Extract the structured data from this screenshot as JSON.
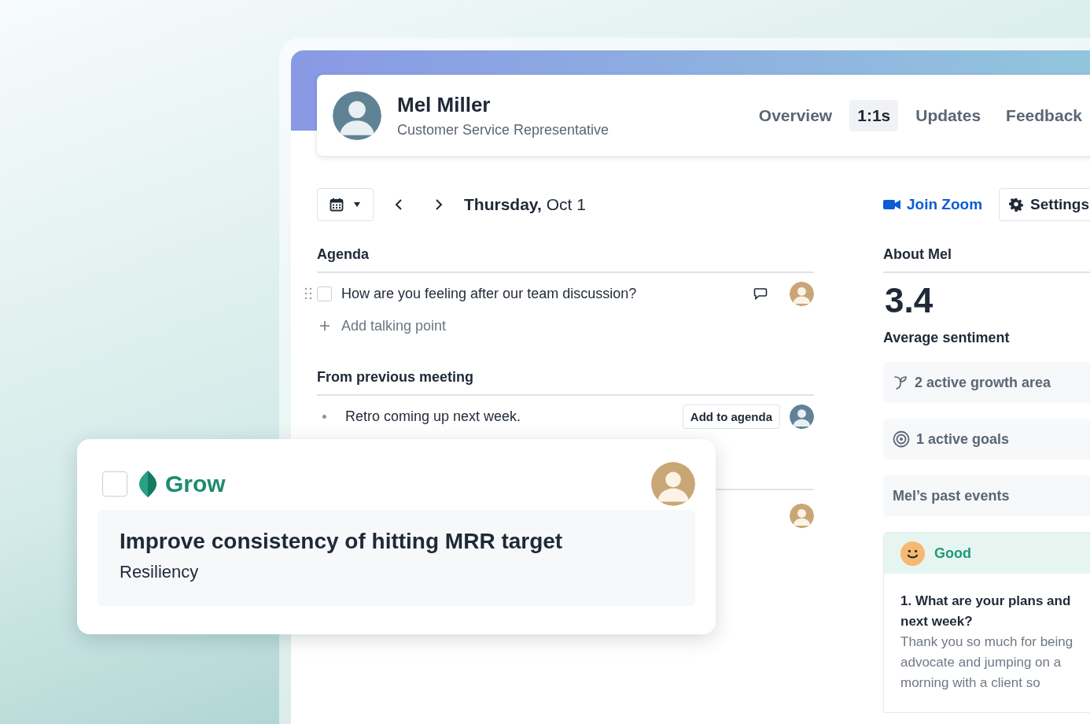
{
  "profile": {
    "name": "Mel Miller",
    "role": "Customer Service Representative"
  },
  "tabs": [
    {
      "label": "Overview",
      "selected": false
    },
    {
      "label": "1:1s",
      "selected": true
    },
    {
      "label": "Updates",
      "selected": false
    },
    {
      "label": "Feedback",
      "selected": false
    }
  ],
  "date": "**Thursday,** Oct 1",
  "agenda": {
    "title": "Agenda",
    "items": [
      {
        "text": "How are you feeling after our team discussion?",
        "checked": false
      }
    ],
    "add_label": "Add talking point"
  },
  "previous": {
    "title": "From previous meeting",
    "items": [
      {
        "text": "Retro coming up next week.",
        "action": "Add to agenda"
      }
    ]
  },
  "actions": {
    "join": "Join Zoom",
    "settings": "Settings"
  },
  "about": {
    "title": "About Mel",
    "score": "3.4",
    "score_label": "Average sentiment",
    "links": [
      {
        "kind": "growth",
        "label": "2 active growth area"
      },
      {
        "kind": "goals",
        "label": "1 active goals"
      },
      {
        "kind": "plain",
        "label": "Mel’s past events"
      }
    ]
  },
  "sentiment": {
    "label": "Good",
    "question": "1. What are your plans and next week?",
    "answer": "Thank you so much for being advocate and jumping on a morning with a client so"
  },
  "goal_card": {
    "checked": false,
    "category": "Grow",
    "title": "Improve consistency of hitting MRR target",
    "subtitle": "Resiliency"
  }
}
